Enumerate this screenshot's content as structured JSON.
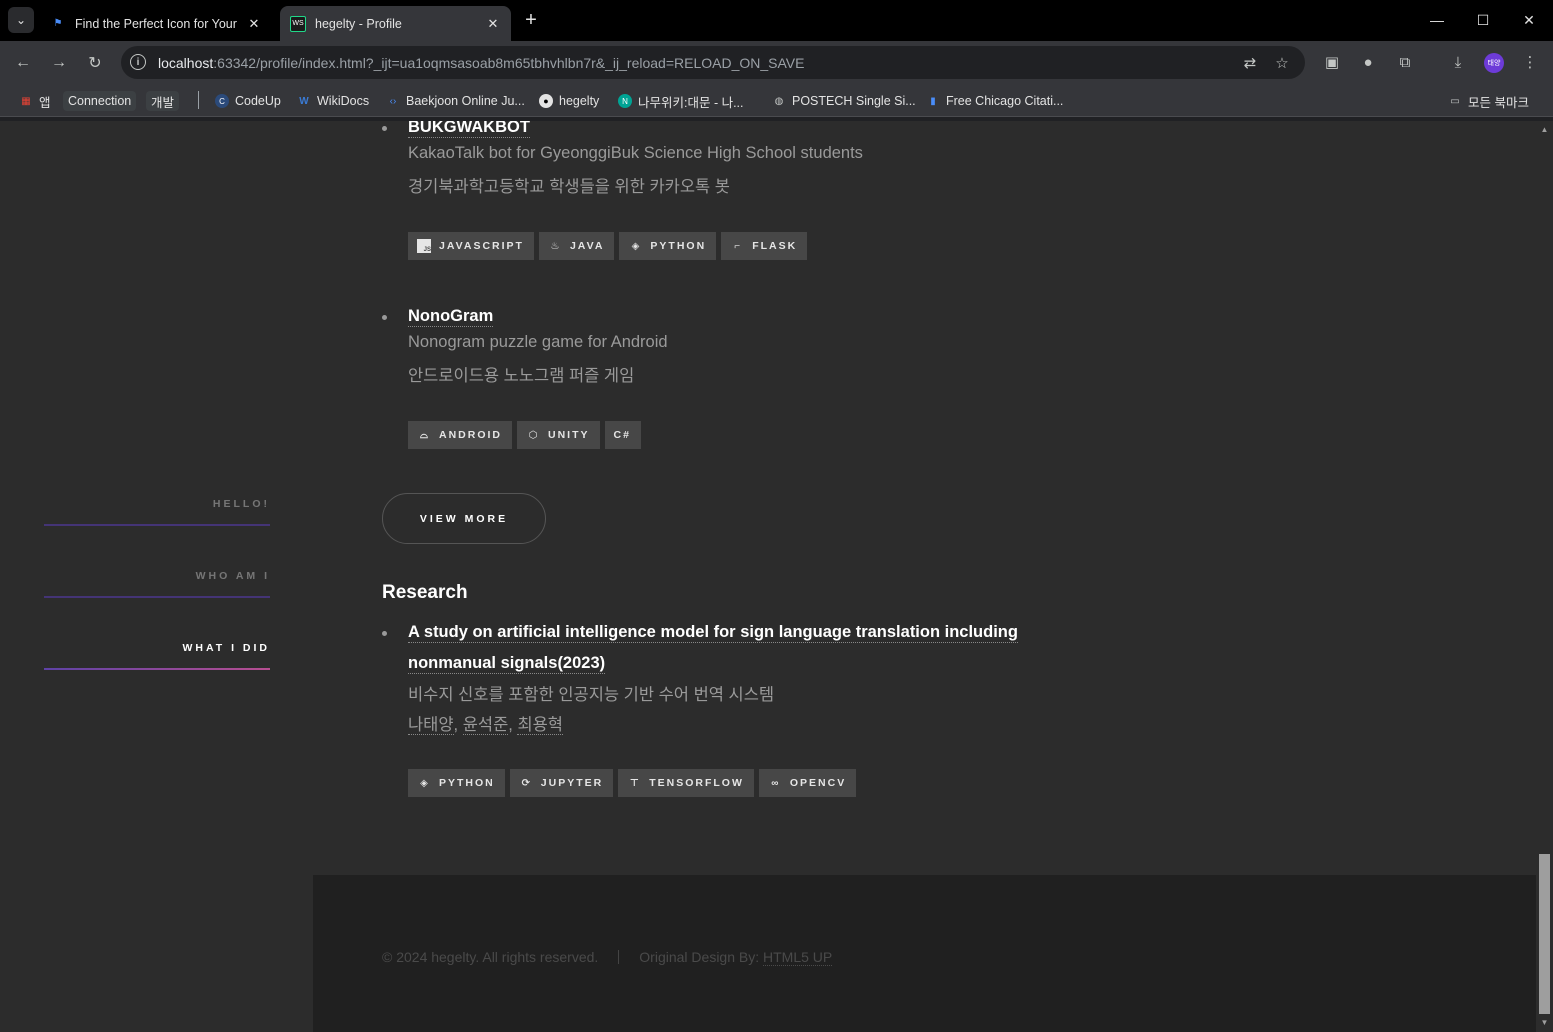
{
  "browser": {
    "tabs": [
      {
        "title": "Find the Perfect Icon for Your",
        "favicon": "flag-icon"
      },
      {
        "title": "hegelty - Profile",
        "favicon": "webstorm-icon"
      }
    ],
    "url_host": "localhost",
    "url_rest": ":63342/profile/index.html?_ijt=ua1oqmsasoab8m65tbhvhlbn7r&_ij_reload=RELOAD_ON_SAVE",
    "bookmarks": {
      "apps": "앱",
      "connection": "Connection",
      "dev": "개발",
      "items": [
        "CodeUp",
        "WikiDocs",
        "Baekjoon Online Ju...",
        "hegelty",
        "나무위키:대문 - 나...",
        "POSTECH Single Si...",
        "Free Chicago Citati..."
      ],
      "all_bookmarks": "모든 북마크"
    },
    "avatar_text": "태양"
  },
  "sidebar": {
    "items": [
      {
        "label": "HELLO!"
      },
      {
        "label": "WHO AM I"
      },
      {
        "label": "WHAT I DID"
      }
    ]
  },
  "projects": [
    {
      "title": "BUKGWAKBOT",
      "desc_en": "KakaoTalk bot for GyeonggiBuk Science High School students",
      "desc_ko": "경기북과학고등학교 학생들을 위한 카카오톡 봇",
      "tags": [
        "JAVASCRIPT",
        "JAVA",
        "PYTHON",
        "FLASK"
      ]
    },
    {
      "title": "NonoGram",
      "desc_en": "Nonogram puzzle game for Android",
      "desc_ko": "안드로이드용 노노그램 퍼즐 게임",
      "tags": [
        "ANDROID",
        "UNITY",
        "C#"
      ]
    }
  ],
  "view_more": "VIEW MORE",
  "research": {
    "heading": "Research",
    "title_line1": "A study on artificial intelligence model for sign language translation including",
    "title_line2": "nonmanual signals(2023)",
    "desc_ko": "비수지 신호를 포함한 인공지능 기반 수어 번역 시스템",
    "authors": [
      "나태양",
      "윤석준",
      "최용혁"
    ],
    "tags": [
      "PYTHON",
      "JUPYTER",
      "TENSORFLOW",
      "OPENCV"
    ]
  },
  "footer": {
    "copyright": "© 2024 hegelty. All rights reserved.",
    "design_label": "Original Design By: ",
    "design_link": "HTML5 UP"
  }
}
